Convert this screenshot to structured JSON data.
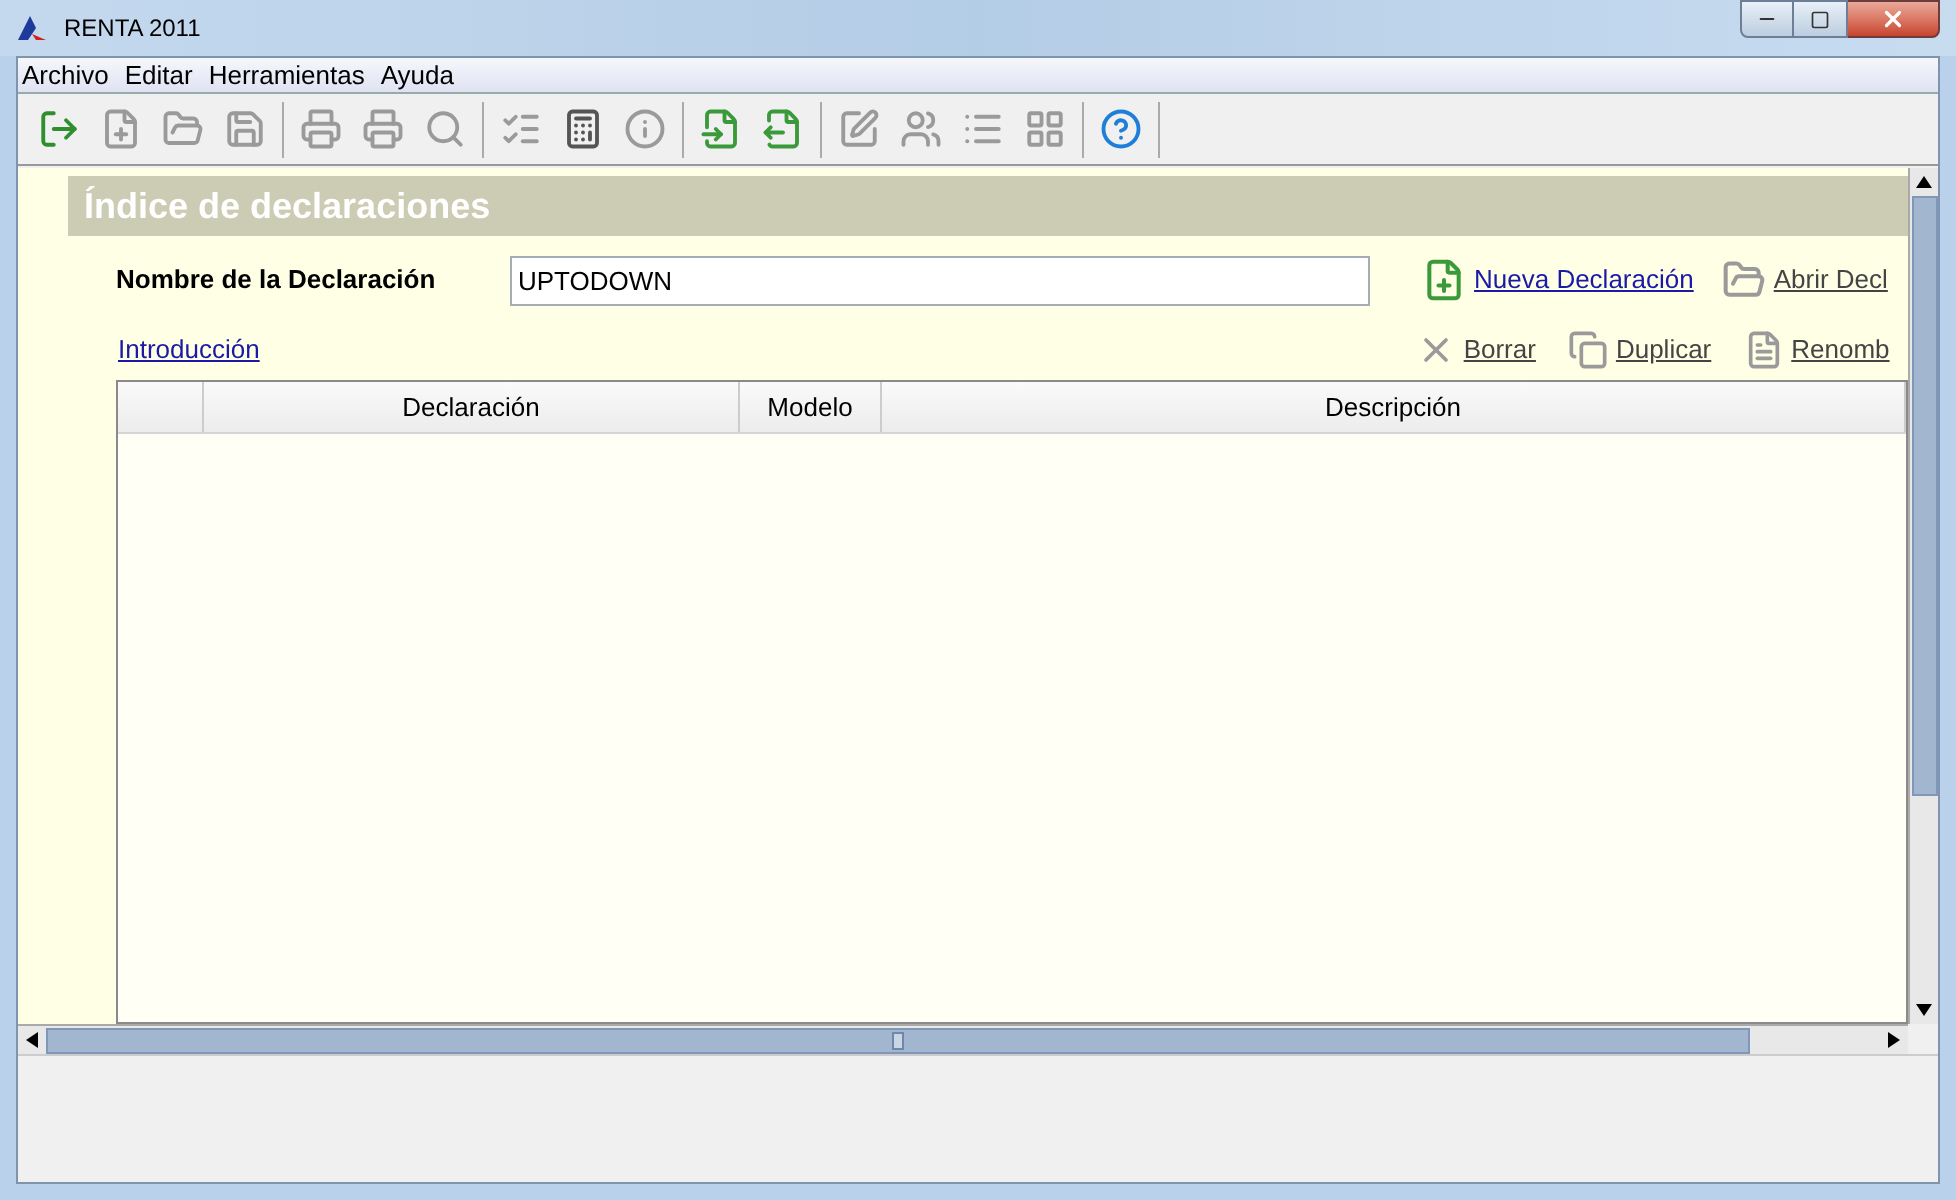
{
  "window": {
    "title": "RENTA 2011"
  },
  "menu": [
    "Archivo",
    "Editar",
    "Herramientas",
    "Ayuda"
  ],
  "toolbar": [
    [
      {
        "kind": "exit",
        "disabled": false
      },
      {
        "kind": "new",
        "disabled": true
      },
      {
        "kind": "open",
        "disabled": true
      },
      {
        "kind": "save",
        "disabled": true
      }
    ],
    [
      {
        "kind": "print",
        "disabled": true
      },
      {
        "kind": "print",
        "disabled": true
      },
      {
        "kind": "preview",
        "disabled": true
      }
    ],
    [
      {
        "kind": "checklist",
        "disabled": true
      },
      {
        "kind": "calculator",
        "disabled": false
      },
      {
        "kind": "info",
        "disabled": true
      }
    ],
    [
      {
        "kind": "import",
        "disabled": false
      },
      {
        "kind": "export",
        "disabled": false
      }
    ],
    [
      {
        "kind": "edit",
        "disabled": true
      },
      {
        "kind": "users",
        "disabled": true
      },
      {
        "kind": "list",
        "disabled": true
      },
      {
        "kind": "layout",
        "disabled": true
      }
    ],
    [
      {
        "kind": "help",
        "disabled": false
      }
    ]
  ],
  "panel": {
    "title": "Índice de declaraciones",
    "name_label": "Nombre de la Declaración",
    "name_value": "UPTODOWN",
    "intro_link": "Introducción",
    "actions_top": [
      {
        "kind": "new",
        "label": "Nueva Declaración",
        "disabled": false
      },
      {
        "kind": "open",
        "label": "Abrir Decl",
        "disabled": true
      }
    ],
    "actions_bottom": [
      {
        "kind": "delete",
        "label": "Borrar",
        "disabled": true
      },
      {
        "kind": "duplicate",
        "label": "Duplicar",
        "disabled": true
      },
      {
        "kind": "rename",
        "label": "Renomb",
        "disabled": true
      }
    ]
  },
  "table": {
    "columns": [
      "Declaración",
      "Modelo",
      "Descripción"
    ]
  }
}
